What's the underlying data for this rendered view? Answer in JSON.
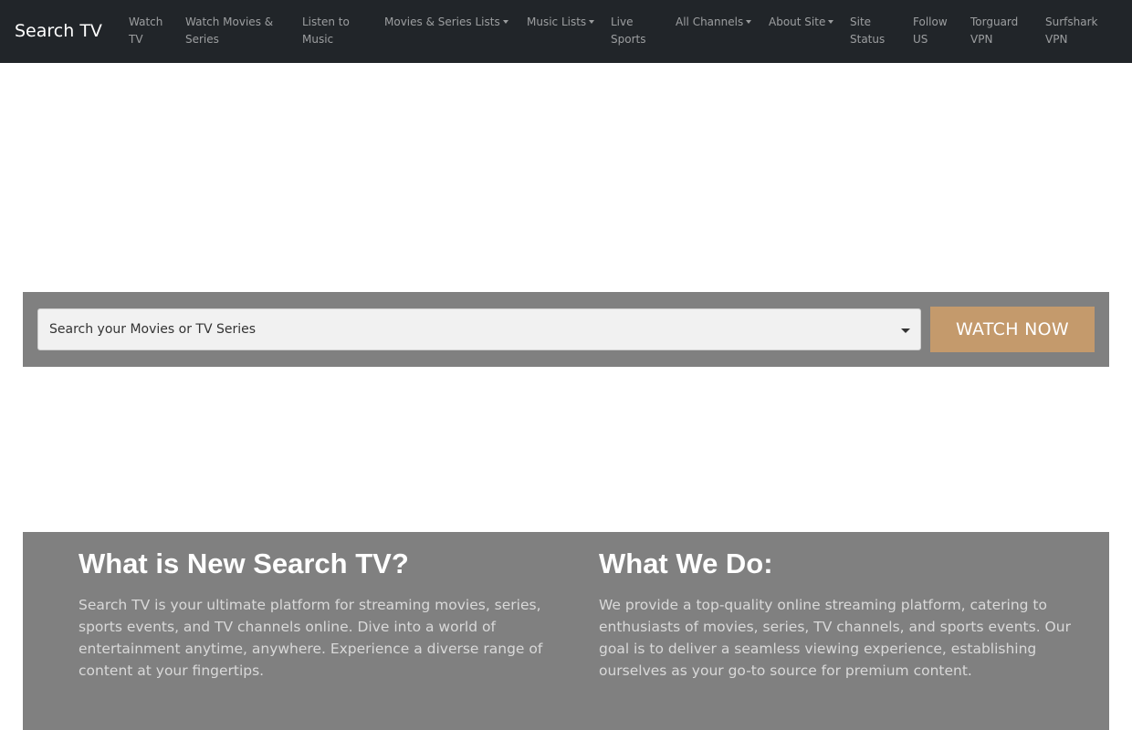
{
  "navbar": {
    "brand": "Search TV",
    "items": [
      {
        "label": "Watch TV",
        "dropdown": false
      },
      {
        "label": "Watch Movies & Series",
        "dropdown": false
      },
      {
        "label": "Listen to Music",
        "dropdown": false
      },
      {
        "label": "Movies & Series Lists",
        "dropdown": true
      },
      {
        "label": "Music Lists",
        "dropdown": true
      },
      {
        "label": "Live Sports",
        "dropdown": false
      },
      {
        "label": "All Channels",
        "dropdown": true
      },
      {
        "label": "About Site",
        "dropdown": true
      },
      {
        "label": "Site Status",
        "dropdown": false
      },
      {
        "label": "Follow US",
        "dropdown": false
      },
      {
        "label": "Torguard VPN",
        "dropdown": false
      },
      {
        "label": "Surfshark VPN",
        "dropdown": false
      }
    ]
  },
  "search": {
    "select_value": "Search your Movies or TV Series",
    "button_label": "WATCH NOW"
  },
  "info": {
    "left": {
      "title": "What is New Search TV?",
      "text": "Search TV is your ultimate platform for streaming movies, series, sports events, and TV channels online. Dive into a world of entertainment anytime, anywhere. Experience a diverse range of content at your fingertips."
    },
    "right": {
      "title": "What We Do:",
      "text": "We provide a top-quality online streaming platform, catering to enthusiasts of movies, series, TV channels, and sports events. Our goal is to deliver a seamless viewing experience, establishing ourselves as your go-to source for premium content."
    }
  },
  "colors": {
    "navbar_bg": "#212529",
    "band_bg": "#808080",
    "button_bg": "#c49a6c"
  }
}
